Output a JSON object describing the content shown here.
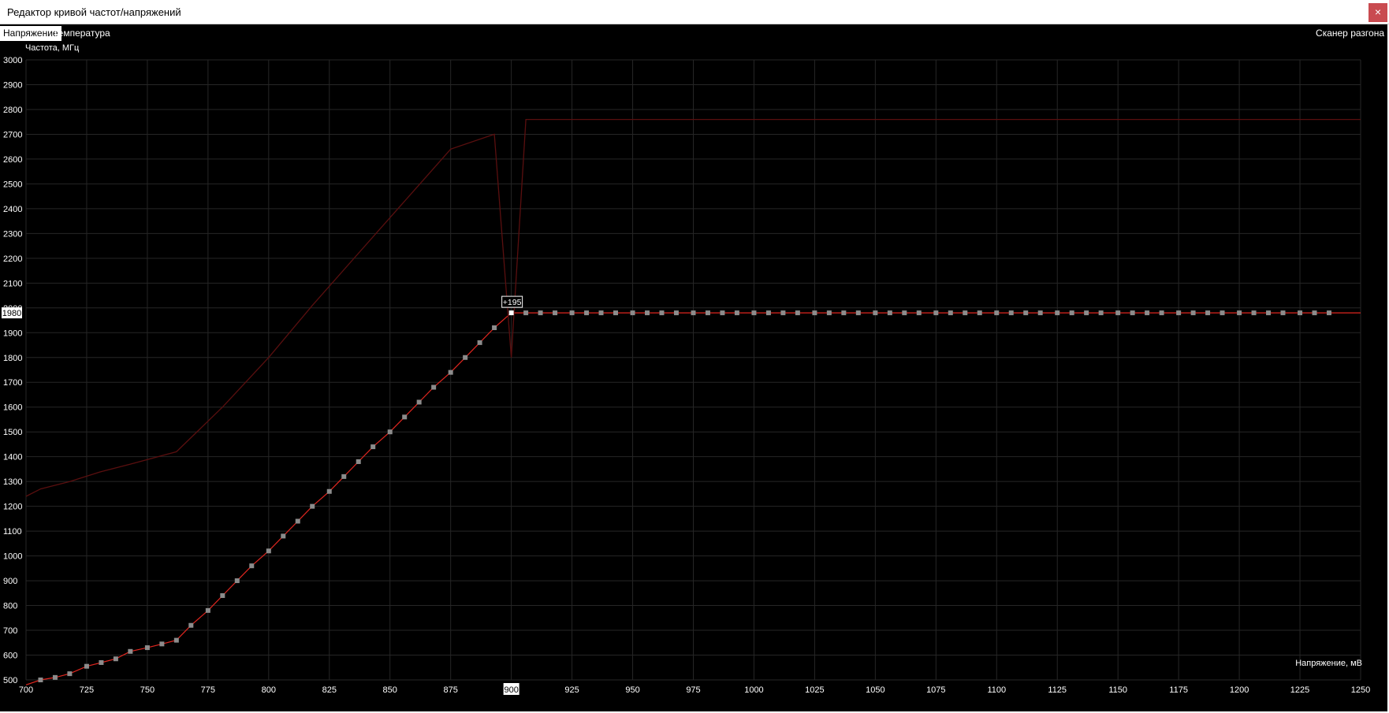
{
  "window": {
    "title": "Редактор кривой частот/напряжений",
    "close_label": "×"
  },
  "tabs": [
    {
      "label": "Напряжение",
      "active": true
    },
    {
      "label": "Температура",
      "active": false
    }
  ],
  "scanner_label": "Сканер разгона",
  "colors": {
    "background": "#000000",
    "grid": "#262626",
    "curve": "#e0261f",
    "limit_curve": "#5a0f0f",
    "point": "#8c8c8c",
    "selected_point": "#ffffff"
  },
  "chart_data": {
    "type": "line",
    "ylabel": "Частота, МГц",
    "xlabel": "Напряжение, мВ",
    "xlim": [
      700,
      1250
    ],
    "ylim": [
      500,
      3000
    ],
    "x_ticks": [
      700,
      725,
      750,
      775,
      800,
      825,
      850,
      875,
      900,
      925,
      950,
      975,
      1000,
      1025,
      1050,
      1075,
      1100,
      1125,
      1150,
      1175,
      1200,
      1225,
      1250
    ],
    "y_ticks": [
      500,
      600,
      700,
      800,
      900,
      1000,
      1100,
      1200,
      1300,
      1400,
      1500,
      1600,
      1700,
      1800,
      1900,
      2000,
      2100,
      2200,
      2300,
      2400,
      2500,
      2600,
      2700,
      2800,
      2900,
      3000
    ],
    "grid": true,
    "selected": {
      "x": 900,
      "y": 1980,
      "x_label": "900",
      "y_label": "1980",
      "offset_label": "+195"
    },
    "series": [
      {
        "role": "curve",
        "x": [
          700,
          706,
          712,
          718,
          725,
          731,
          737,
          743,
          750,
          756,
          762,
          768,
          775,
          781,
          787,
          793,
          800,
          806,
          812,
          818,
          825,
          831,
          837,
          843,
          850,
          856,
          862,
          868,
          875,
          881,
          887,
          893,
          900,
          906,
          912,
          918,
          925,
          931,
          937,
          943,
          950,
          956,
          962,
          968,
          975,
          981,
          987,
          993,
          1000,
          1006,
          1012,
          1018,
          1025,
          1031,
          1037,
          1043,
          1050,
          1056,
          1062,
          1068,
          1075,
          1081,
          1087,
          1093,
          1100,
          1106,
          1112,
          1118,
          1125,
          1131,
          1137,
          1143,
          1150,
          1156,
          1162,
          1168,
          1175,
          1181,
          1187,
          1193,
          1200,
          1206,
          1212,
          1218,
          1225,
          1231,
          1237,
          1250
        ],
        "y": [
          480,
          500,
          510,
          525,
          555,
          570,
          585,
          615,
          630,
          645,
          660,
          720,
          780,
          840,
          900,
          960,
          1020,
          1080,
          1140,
          1200,
          1260,
          1320,
          1380,
          1440,
          1500,
          1560,
          1620,
          1680,
          1740,
          1800,
          1860,
          1920,
          1980,
          1980,
          1980,
          1980,
          1980,
          1980,
          1980,
          1980,
          1980,
          1980,
          1980,
          1980,
          1980,
          1980,
          1980,
          1980,
          1980,
          1980,
          1980,
          1980,
          1980,
          1980,
          1980,
          1980,
          1980,
          1980,
          1980,
          1980,
          1980,
          1980,
          1980,
          1980,
          1980,
          1980,
          1980,
          1980,
          1980,
          1980,
          1980,
          1980,
          1980,
          1980,
          1980,
          1980,
          1980,
          1980,
          1980,
          1980,
          1980,
          1980,
          1980,
          1980,
          1980,
          1980,
          1980,
          1980
        ]
      },
      {
        "role": "limit",
        "x": [
          700,
          706,
          718,
          731,
          743,
          762,
          781,
          800,
          818,
          837,
          856,
          875,
          893,
          900,
          906,
          1250
        ],
        "y": [
          1240,
          1270,
          1300,
          1340,
          1370,
          1420,
          1600,
          1800,
          2010,
          2220,
          2430,
          2640,
          2700,
          1800,
          2760,
          2760
        ]
      }
    ],
    "point_x": [
      706,
      712,
      718,
      725,
      731,
      737,
      743,
      750,
      756,
      762,
      768,
      775,
      781,
      787,
      793,
      800,
      806,
      812,
      818,
      825,
      831,
      837,
      843,
      850,
      856,
      862,
      868,
      875,
      881,
      887,
      893,
      900,
      906,
      912,
      918,
      925,
      931,
      937,
      943,
      950,
      956,
      962,
      968,
      975,
      981,
      987,
      993,
      1000,
      1006,
      1012,
      1018,
      1025,
      1031,
      1037,
      1043,
      1050,
      1056,
      1062,
      1068,
      1075,
      1081,
      1087,
      1093,
      1100,
      1106,
      1112,
      1118,
      1125,
      1131,
      1137,
      1143,
      1150,
      1156,
      1162,
      1168,
      1175,
      1181,
      1187,
      1193,
      1200,
      1206,
      1212,
      1218,
      1225,
      1231,
      1237
    ]
  }
}
